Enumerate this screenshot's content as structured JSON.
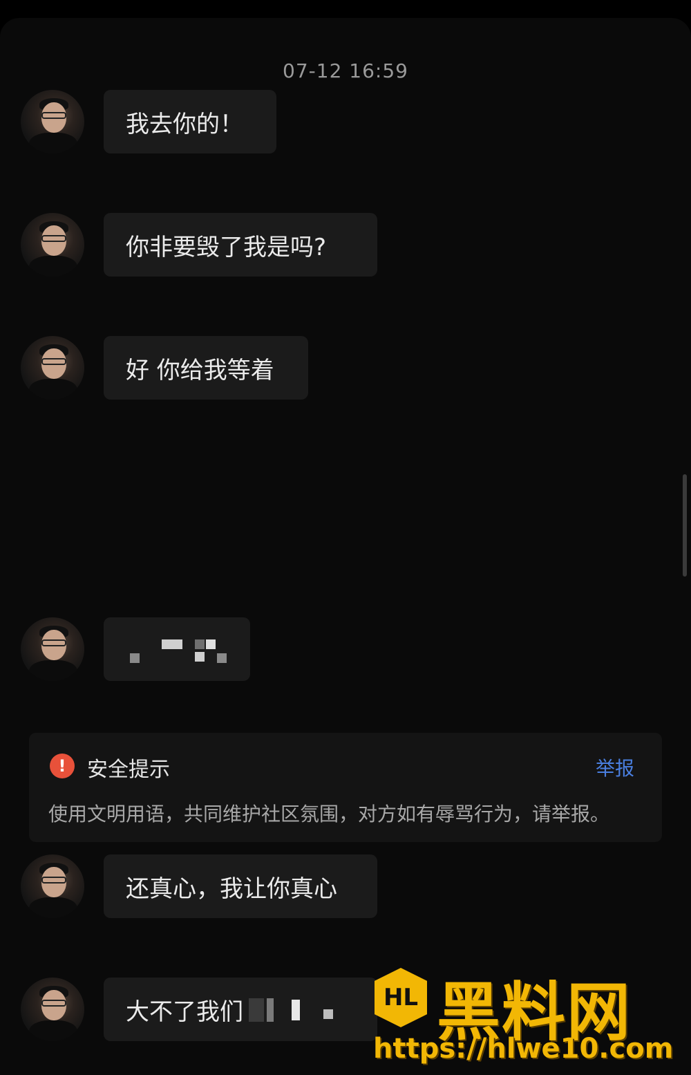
{
  "chat": {
    "timestamp": "07-12 16:59",
    "messages": [
      {
        "text": "我去你的！",
        "redacted": false
      },
      {
        "text": "你非要毁了我是吗?",
        "redacted": false
      },
      {
        "text": "好 你给我等着",
        "redacted": false
      },
      {
        "text": "",
        "redacted": true
      },
      {
        "text": "还真心，我让你真心",
        "redacted": false
      },
      {
        "text": "大不了我们",
        "redacted": true
      }
    ]
  },
  "safety_notice": {
    "icon": "exclamation-icon",
    "title": "安全提示",
    "report_label": "举报",
    "body": "使用文明用语，共同维护社区氛围，对方如有辱骂行为，请举报。"
  },
  "watermark": {
    "logo_text": "HL",
    "brand": "黑料网",
    "url": "https://hlwe10.com"
  },
  "colors": {
    "background": "#0a0a0a",
    "bubble": "#1b1b1b",
    "link": "#4a7fe0",
    "warning": "#e8513a",
    "watermark": "#f2b705"
  }
}
